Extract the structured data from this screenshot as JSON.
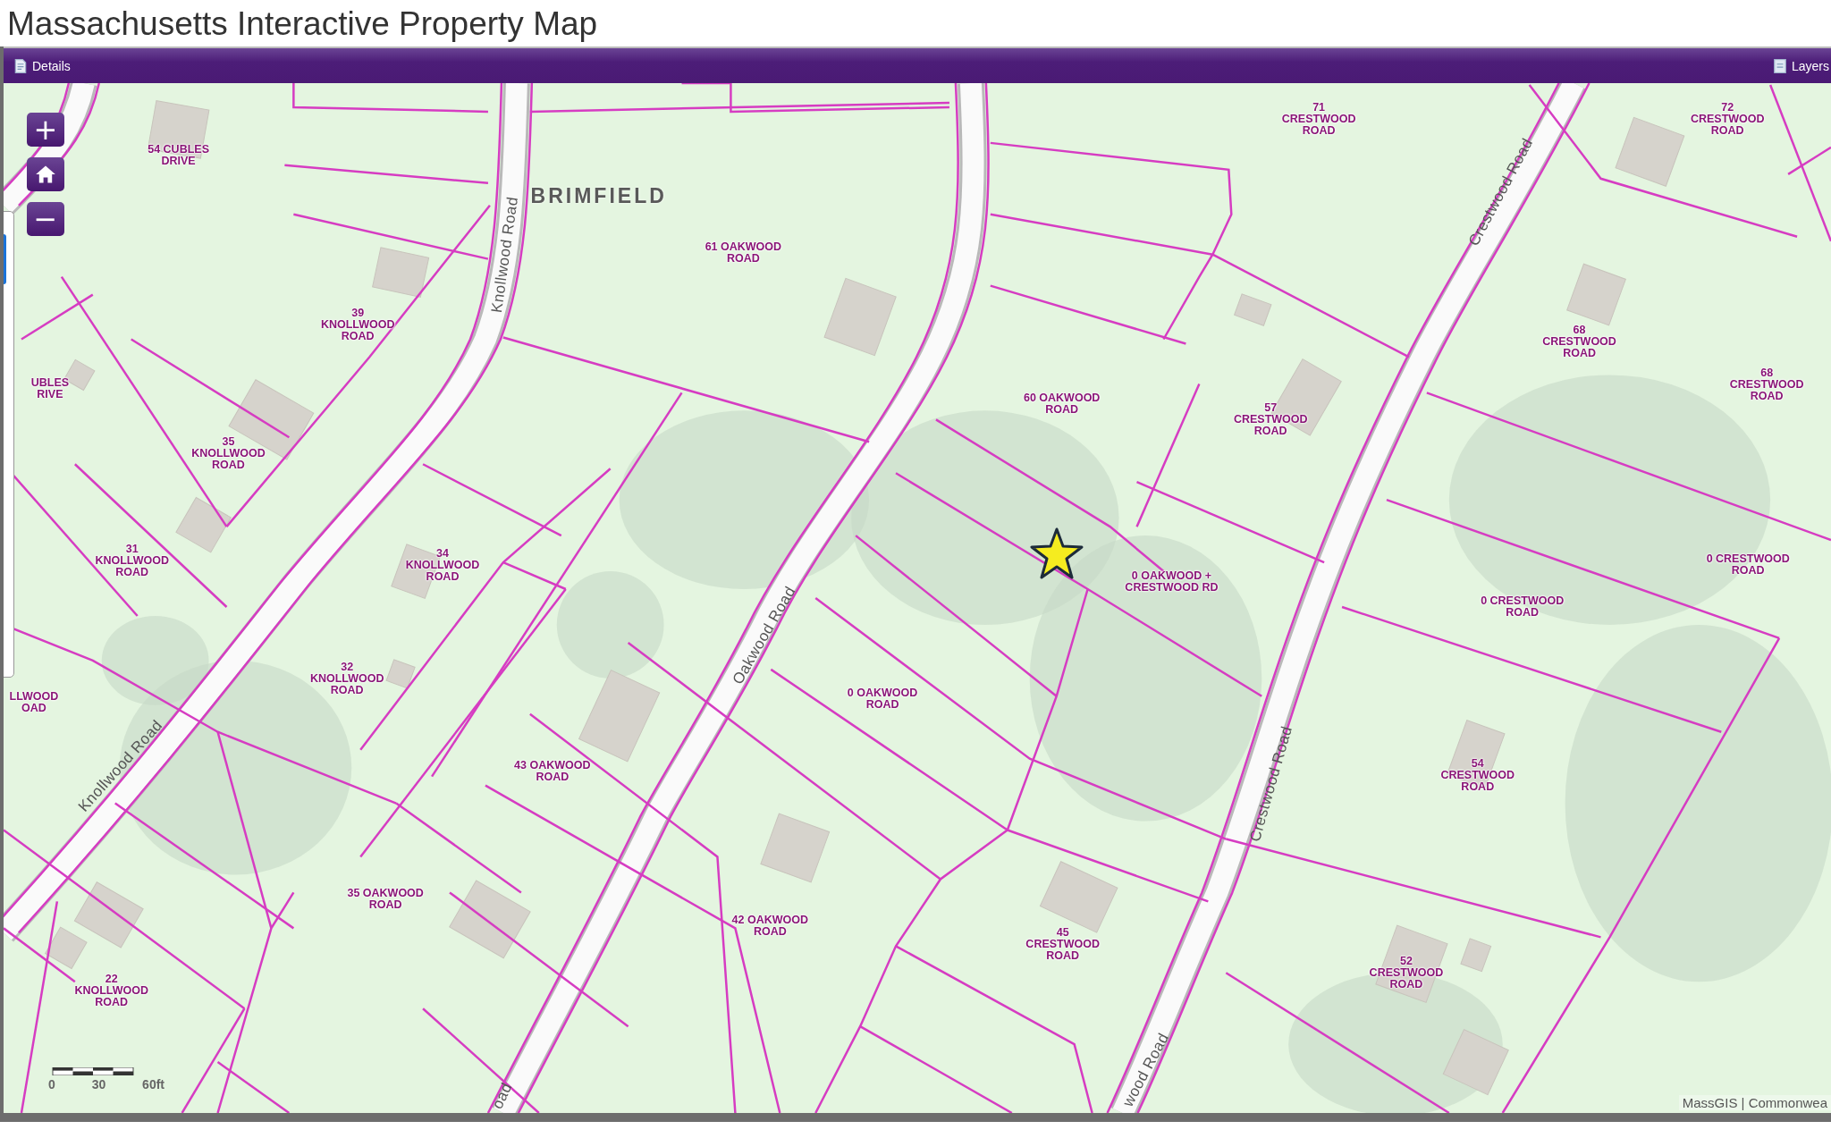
{
  "page_title": "Massachusetts Interactive Property Map",
  "toolbar": {
    "left": {
      "label": "Details"
    },
    "right": {
      "label": "Layers"
    }
  },
  "zoom_controls": [
    {
      "kind": "zoom-in",
      "symbol": "+"
    },
    {
      "kind": "home"
    },
    {
      "kind": "zoom-out",
      "symbol": "−"
    }
  ],
  "town_label": "BRIMFIELD",
  "parcel_labels": [
    {
      "text": "54 CUBLES\nDRIVE"
    },
    {
      "text": "61 OAKWOOD\nROAD"
    },
    {
      "text": "39\nKNOLLWOOD\nROAD"
    },
    {
      "text": "UBLES\nRIVE"
    },
    {
      "text": "35\nKNOLLWOOD\nROAD"
    },
    {
      "text": "60 OAKWOOD\nROAD"
    },
    {
      "text": "57\nCRESTWOOD\nROAD"
    },
    {
      "text": "71\nCRESTWOOD\nROAD"
    },
    {
      "text": "72\nCRESTWOOD\nROAD"
    },
    {
      "text": "68\nCRESTWOOD\nROAD"
    },
    {
      "text": "68\nCRESTWOOD\nROAD"
    },
    {
      "text": "31\nKNOLLWOOD\nROAD"
    },
    {
      "text": "34\nKNOLLWOOD\nROAD"
    },
    {
      "text": "0 OAKWOOD +\nCRESTWOOD RD"
    },
    {
      "text": "0 CRESTWOOD\nROAD"
    },
    {
      "text": "0 CRESTWOOD\nROAD"
    },
    {
      "text": "LLWOOD\nOAD"
    },
    {
      "text": "32\nKNOLLWOOD\nROAD"
    },
    {
      "text": "43 OAKWOOD\nROAD"
    },
    {
      "text": "0 OAKWOOD\nROAD"
    },
    {
      "text": "54\nCRESTWOOD\nROAD"
    },
    {
      "text": "35 OAKWOOD\nROAD"
    },
    {
      "text": "42 OAKWOOD\nROAD"
    },
    {
      "text": "45\nCRESTWOOD\nROAD"
    },
    {
      "text": "52\nCRESTWOOD\nROAD"
    },
    {
      "text": "22\nKNOLLWOOD\nROAD"
    }
  ],
  "road_labels": [
    {
      "text": "Knollwood Road"
    },
    {
      "text": "Knollwood Road"
    },
    {
      "text": "Oakwood Road"
    },
    {
      "text": "Crestwood Road"
    },
    {
      "text": "Crestwood Road"
    },
    {
      "text": "wood Road"
    },
    {
      "text": "oad"
    }
  ],
  "scale_bar": {
    "ticks": [
      "0",
      "30",
      "60ft"
    ]
  },
  "attribution": "MassGIS | Commonwea"
}
